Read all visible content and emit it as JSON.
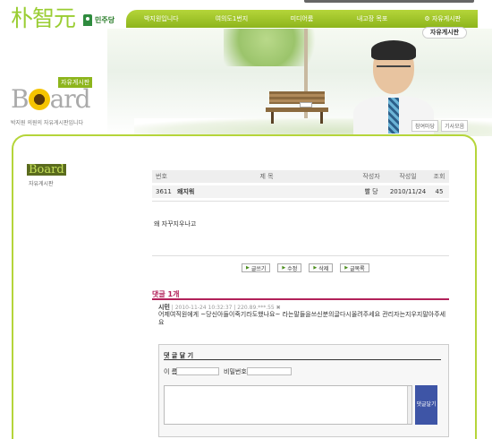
{
  "header": {
    "logo_text": "朴智元",
    "party_name": "민주당",
    "nav": [
      "박지원입니다",
      "여의도1번지",
      "미디어룸",
      "내고장 목포",
      "자유게시판"
    ],
    "board_button": "자유게시판"
  },
  "hero": {
    "links": [
      "참여마당",
      "기사모음"
    ]
  },
  "board_header": {
    "badge": "자유게시판",
    "big_title_pre": "B",
    "big_title_post": "ard",
    "subtitle": "박지원 의원의 자유게시판입니다"
  },
  "sidebar": {
    "title": "Board",
    "subtitle": "자유게시판"
  },
  "table": {
    "headers": [
      "번호",
      "제 목",
      "작성자",
      "작성일",
      "조회"
    ],
    "row": {
      "no": "3611",
      "title": "왜지워",
      "author": "빨 당",
      "date": "2010/11/24",
      "views": "45"
    }
  },
  "post": {
    "content": "왜 자꾸지우나고"
  },
  "actions": [
    "글쓰기",
    "수정",
    "삭제",
    "글목록"
  ],
  "comments": {
    "title": "댓글 1개",
    "author": "시민",
    "meta": "2010-11-24 10:32:37 | 220.89.***.55",
    "text": "어제여직원에게 ~당신아들이죽기라도했나요~ 라는말들을쓰신분의글다시올려주세요 관리자는지우지말아주세요"
  },
  "comment_form": {
    "title": "댓 글 달 기",
    "name_label": "이 름",
    "pw_label": "비밀번호",
    "submit_label": "댓글달기"
  }
}
